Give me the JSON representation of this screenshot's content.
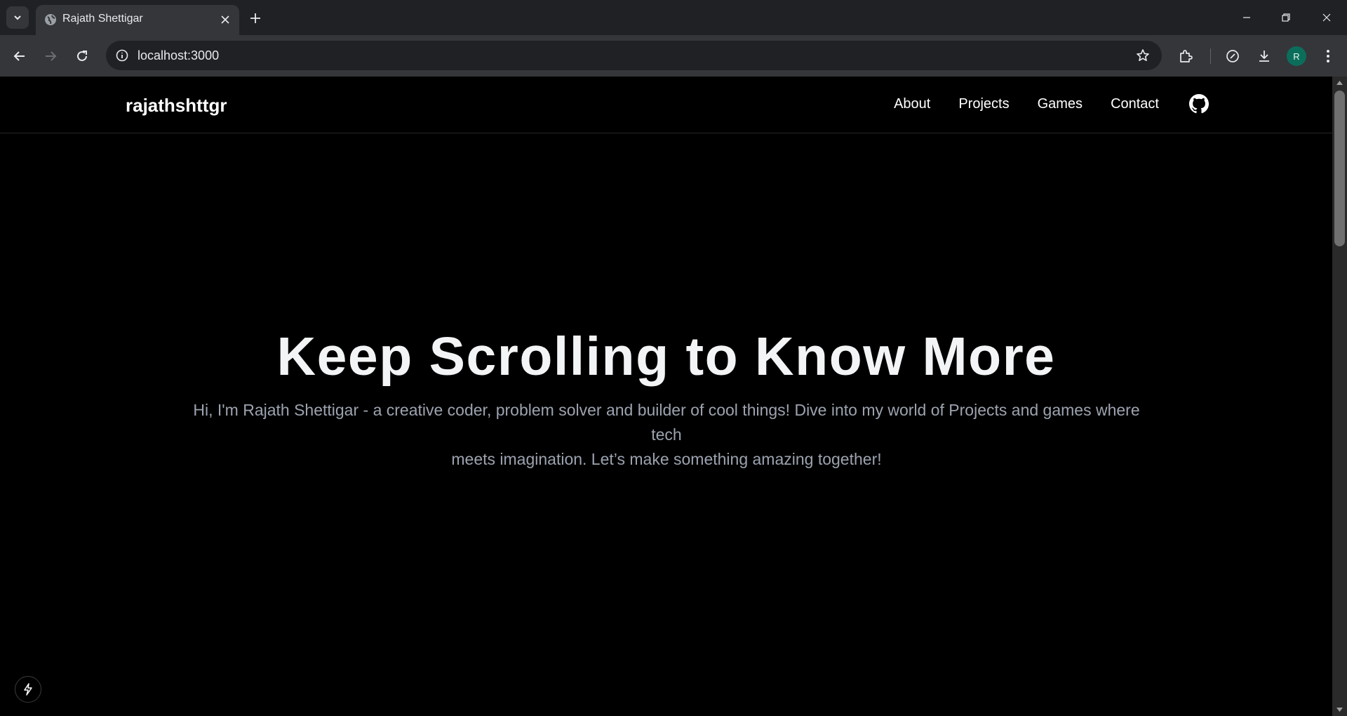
{
  "browser": {
    "tab_title": "Rajath Shettigar",
    "url": "localhost:3000",
    "avatar_initial": "R",
    "icons": {
      "tab_search": "chevron-down-icon",
      "favicon": "globe-icon",
      "close": "close-icon",
      "new_tab": "plus-icon",
      "back": "arrow-left-icon",
      "forward": "arrow-right-icon",
      "reload": "reload-icon",
      "site_info": "info-icon",
      "bookmark": "star-icon",
      "extensions": "puzzle-icon",
      "performance": "speedometer-icon",
      "downloads": "download-icon",
      "menu": "kebab-menu-icon"
    }
  },
  "site": {
    "brand": "rajathshttgr",
    "nav": [
      "About",
      "Projects",
      "Games",
      "Contact"
    ],
    "github_icon": "github-icon"
  },
  "hero": {
    "title": "Keep Scrolling to Know More",
    "subtitle_line1": "Hi, I'm Rajath Shettigar - a creative coder, problem solver and builder of cool things! Dive into my world of Projects and games where tech",
    "subtitle_line2": "meets imagination. Let’s make something amazing together!"
  },
  "colors": {
    "page_bg": "#000000",
    "title": "#f3f4f6",
    "subtitle": "#9ca3af",
    "chrome_bg": "#202124",
    "chrome_toolbar": "#35363a",
    "avatar": "#0b6e5b"
  }
}
